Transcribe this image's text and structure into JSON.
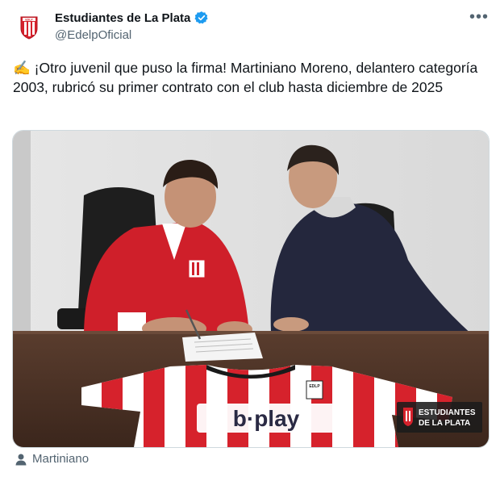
{
  "author": {
    "display_name": "Estudiantes de La Plata",
    "handle": "@EdelpOficial",
    "verified": true,
    "avatar_icon": "edlp-crest-icon"
  },
  "tweet": {
    "text": "✍️ ¡Otro juvenil que puso la firma! Martiniano Moreno, delantero categoría 2003, rubricó su primer contrato con el club hasta diciembre de 2025"
  },
  "media": {
    "jersey_sponsor": "b·play",
    "jersey_crest_text": "EDLP",
    "watermark_line1": "ESTUDIANTES",
    "watermark_line2": "DE LA PLATA"
  },
  "tagged_user": "Martiniano",
  "colors": {
    "club_red": "#d6222c",
    "verified_blue": "#1d9bf0",
    "text_primary": "#0f1419",
    "text_secondary": "#536471"
  }
}
